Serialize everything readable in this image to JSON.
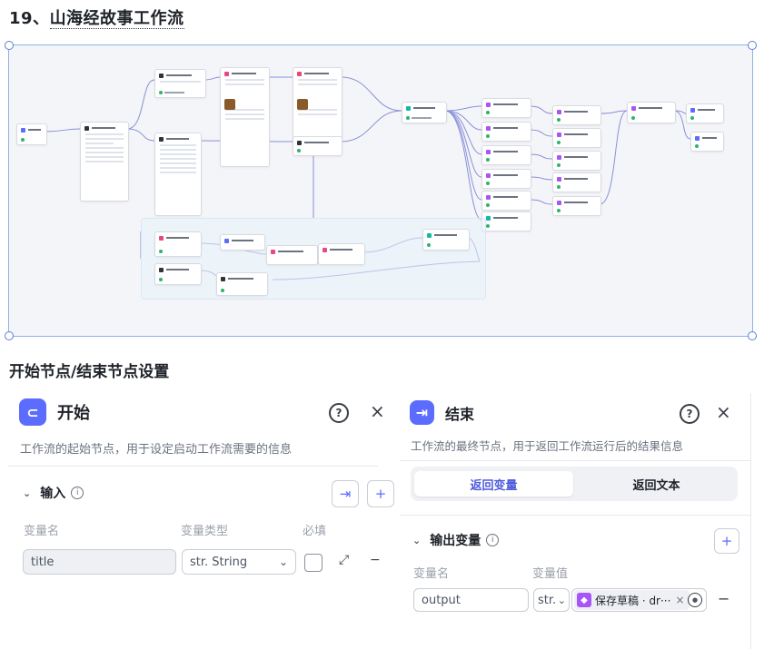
{
  "heading": {
    "prefix": "19、",
    "underlined": "山海经故事工作流"
  },
  "section2_heading": "开始节点/结束节点设置",
  "start_panel": {
    "title": "开始",
    "description": "工作流的起始节点，用于设定启动工作流需要的信息",
    "section_label": "输入",
    "col_name": "变量名",
    "col_type": "变量类型",
    "col_required": "必填",
    "var_name": "title",
    "var_type": "str. String"
  },
  "end_panel": {
    "title": "结束",
    "description": "工作流的最终节点，用于返回工作流运行后的结果信息",
    "tab_active": "返回变量",
    "tab_inactive": "返回文本",
    "section_label": "输出变量",
    "col_name": "变量名",
    "col_value": "变量值",
    "var_name": "output",
    "var_type": "str.",
    "ref_tag": "保存草稿 · dr···"
  },
  "colors": {
    "accent": "#5b6cff",
    "tab_accent": "#4d5bde",
    "tag_icon": "#a855f7",
    "success": "#2fb36b",
    "canvas_border": "#8fb2e8"
  }
}
